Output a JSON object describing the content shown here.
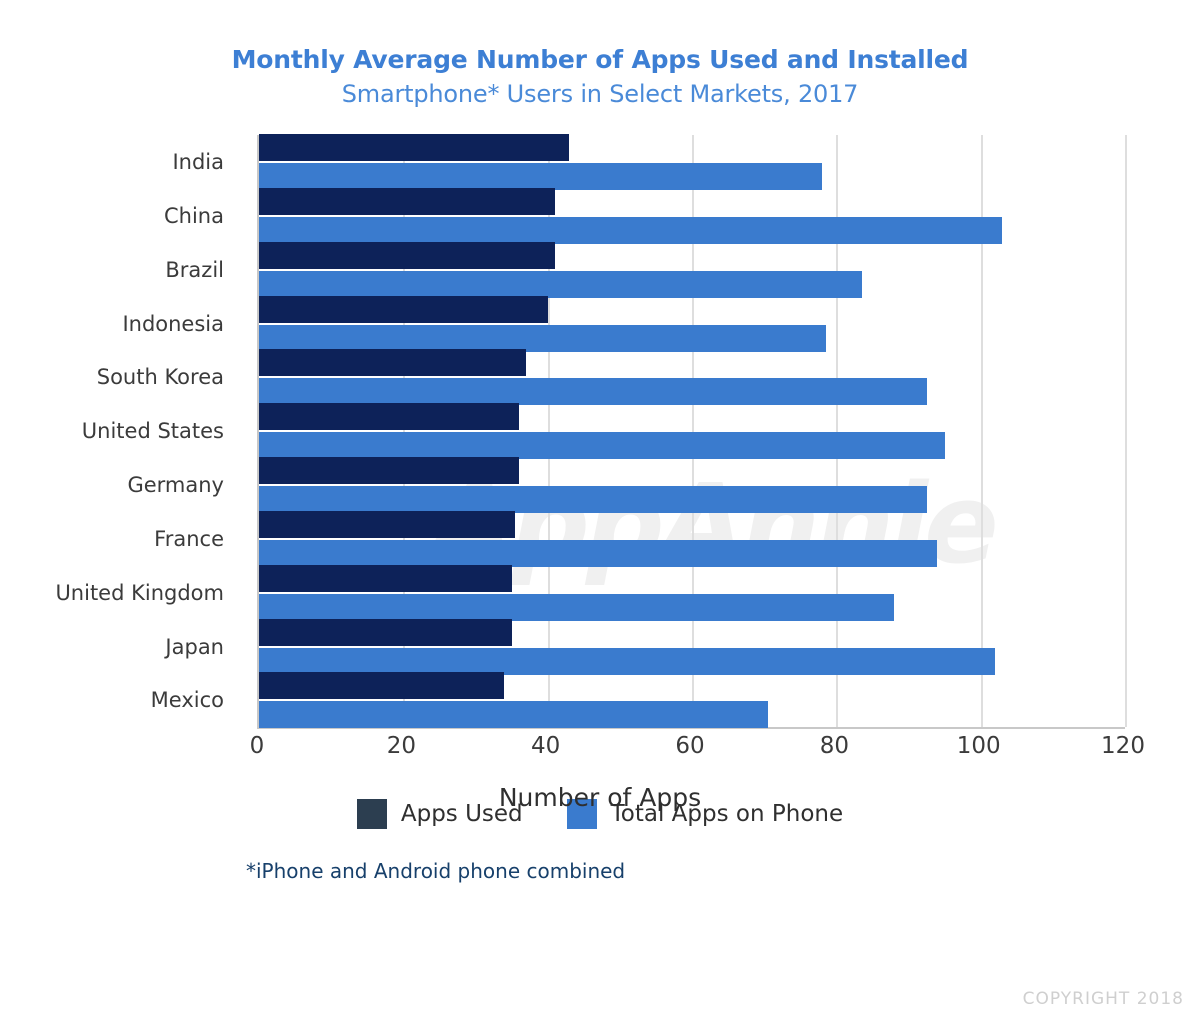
{
  "header": {
    "title": "Monthly Average Number of Apps Used and Installed",
    "subtitle": "Smartphone* Users in Select Markets, 2017",
    "title_color": "#3d7fd4",
    "subtitle_color": "#4a8ad8"
  },
  "footnote": "*iPhone and Android phone combined",
  "copyright": "COPYRIGHT 2018",
  "watermark": "AppAnnie",
  "legend": {
    "position": "bottom",
    "items": [
      {
        "label": "Apps Used",
        "color": "#2c3e50"
      },
      {
        "label": "Total Apps on Phone",
        "color": "#3a7bce"
      }
    ]
  },
  "chart_data": {
    "type": "bar",
    "orientation": "horizontal",
    "title": "Monthly Average Number of Apps Used and Installed",
    "subtitle": "Smartphone* Users in Select Markets, 2017",
    "xlabel": "Number of Apps",
    "ylabel": "",
    "xlim": [
      0,
      120
    ],
    "xticks": [
      0,
      20,
      40,
      60,
      80,
      100,
      120
    ],
    "xtick_labels": [
      "0",
      "20",
      "40",
      "60",
      "80",
      "100",
      "120"
    ],
    "grid": "vertical",
    "categories": [
      "India",
      "China",
      "Brazil",
      "Indonesia",
      "South Korea",
      "United States",
      "Germany",
      "France",
      "United Kingdom",
      "Japan",
      "Mexico"
    ],
    "series": [
      {
        "name": "Apps Used",
        "color": "#0d2259",
        "values": [
          43,
          41,
          41,
          40,
          37,
          36,
          36,
          35.5,
          35,
          35,
          34
        ]
      },
      {
        "name": "Total Apps on Phone",
        "color": "#3a7bce",
        "values": [
          78,
          103,
          83.5,
          78.5,
          92.5,
          95,
          92.5,
          94,
          88,
          102,
          70.5
        ]
      }
    ]
  }
}
